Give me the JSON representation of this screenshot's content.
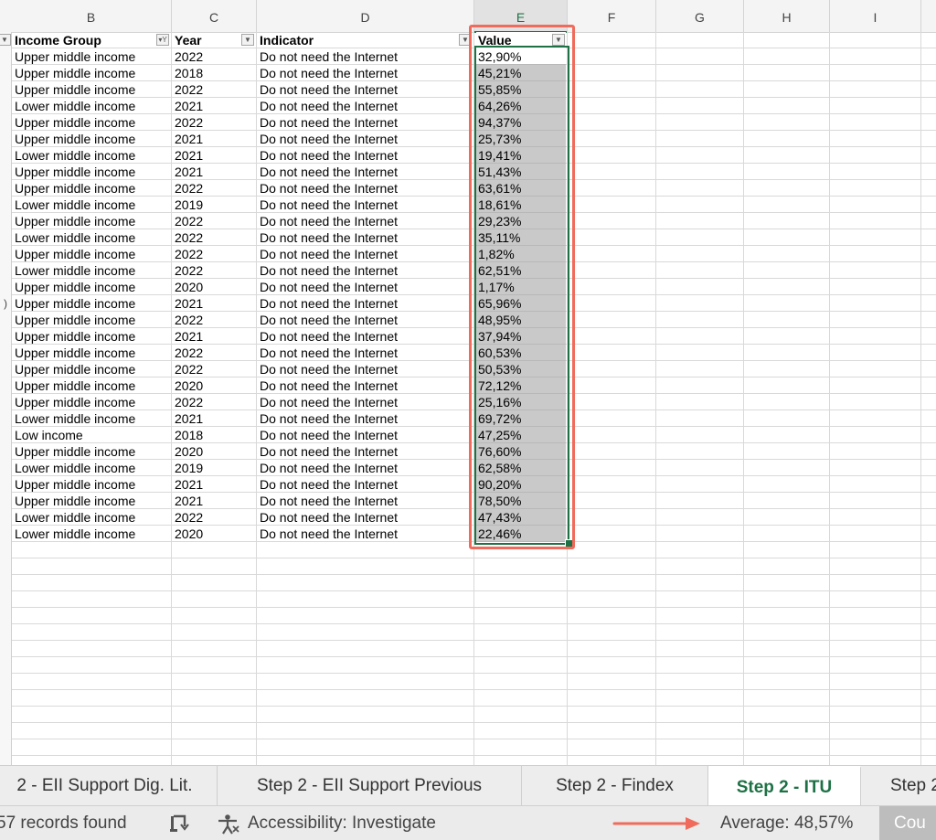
{
  "columns": {
    "b": "B",
    "c": "C",
    "d": "D",
    "e": "E",
    "f": "F",
    "g": "G",
    "h": "H",
    "i": "I"
  },
  "header": {
    "income_group": "Income Group",
    "year": "Year",
    "indicator": "Indicator",
    "value": "Value"
  },
  "row_stub_glyph": ")",
  "rows": [
    {
      "group": "Upper middle income",
      "year": "2022",
      "indicator": "Do not need the Internet",
      "value": "32,90%"
    },
    {
      "group": "Upper middle income",
      "year": "2018",
      "indicator": "Do not need the Internet",
      "value": "45,21%"
    },
    {
      "group": "Upper middle income",
      "year": "2022",
      "indicator": "Do not need the Internet",
      "value": "55,85%"
    },
    {
      "group": "Lower middle income",
      "year": "2021",
      "indicator": "Do not need the Internet",
      "value": "64,26%"
    },
    {
      "group": "Upper middle income",
      "year": "2022",
      "indicator": "Do not need the Internet",
      "value": "94,37%"
    },
    {
      "group": "Upper middle income",
      "year": "2021",
      "indicator": "Do not need the Internet",
      "value": "25,73%"
    },
    {
      "group": "Lower middle income",
      "year": "2021",
      "indicator": "Do not need the Internet",
      "value": "19,41%"
    },
    {
      "group": "Upper middle income",
      "year": "2021",
      "indicator": "Do not need the Internet",
      "value": "51,43%"
    },
    {
      "group": "Upper middle income",
      "year": "2022",
      "indicator": "Do not need the Internet",
      "value": "63,61%"
    },
    {
      "group": "Lower middle income",
      "year": "2019",
      "indicator": "Do not need the Internet",
      "value": "18,61%"
    },
    {
      "group": "Upper middle income",
      "year": "2022",
      "indicator": "Do not need the Internet",
      "value": "29,23%"
    },
    {
      "group": "Lower middle income",
      "year": "2022",
      "indicator": "Do not need the Internet",
      "value": "35,11%"
    },
    {
      "group": "Upper middle income",
      "year": "2022",
      "indicator": "Do not need the Internet",
      "value": "1,82%"
    },
    {
      "group": "Lower middle income",
      "year": "2022",
      "indicator": "Do not need the Internet",
      "value": "62,51%"
    },
    {
      "group": "Upper middle income",
      "year": "2020",
      "indicator": "Do not need the Internet",
      "value": "1,17%"
    },
    {
      "group": "Upper middle income",
      "year": "2021",
      "indicator": "Do not need the Internet",
      "value": "65,96%"
    },
    {
      "group": "Upper middle income",
      "year": "2022",
      "indicator": "Do not need the Internet",
      "value": "48,95%"
    },
    {
      "group": "Upper middle income",
      "year": "2021",
      "indicator": "Do not need the Internet",
      "value": "37,94%"
    },
    {
      "group": "Upper middle income",
      "year": "2022",
      "indicator": "Do not need the Internet",
      "value": "60,53%"
    },
    {
      "group": "Upper middle income",
      "year": "2022",
      "indicator": "Do not need the Internet",
      "value": "50,53%"
    },
    {
      "group": "Upper middle income",
      "year": "2020",
      "indicator": "Do not need the Internet",
      "value": "72,12%"
    },
    {
      "group": "Upper middle income",
      "year": "2022",
      "indicator": "Do not need the Internet",
      "value": "25,16%"
    },
    {
      "group": "Lower middle income",
      "year": "2021",
      "indicator": "Do not need the Internet",
      "value": "69,72%"
    },
    {
      "group": "Low income",
      "year": "2018",
      "indicator": "Do not need the Internet",
      "value": "47,25%"
    },
    {
      "group": "Upper middle income",
      "year": "2020",
      "indicator": "Do not need the Internet",
      "value": "76,60%"
    },
    {
      "group": "Lower middle income",
      "year": "2019",
      "indicator": "Do not need the Internet",
      "value": "62,58%"
    },
    {
      "group": "Upper middle income",
      "year": "2021",
      "indicator": "Do not need the Internet",
      "value": "90,20%"
    },
    {
      "group": "Upper middle income",
      "year": "2021",
      "indicator": "Do not need the Internet",
      "value": "78,50%"
    },
    {
      "group": "Lower middle income",
      "year": "2022",
      "indicator": "Do not need the Internet",
      "value": "47,43%"
    },
    {
      "group": "Lower middle income",
      "year": "2020",
      "indicator": "Do not need the Internet",
      "value": "22,46%"
    }
  ],
  "tabs": [
    {
      "label": "2 - EII Support Dig. Lit.",
      "active": false
    },
    {
      "label": "Step 2 - EII Support Previous",
      "active": false
    },
    {
      "label": "Step 2 - Findex",
      "active": false
    },
    {
      "label": "Step 2 - ITU",
      "active": true
    },
    {
      "label": "Step 2",
      "active": false
    }
  ],
  "status": {
    "records": "57 records found",
    "accessibility": "Accessibility: Investigate",
    "average": "Average: 48,57%",
    "count": "Cou"
  },
  "colors": {
    "excel_green": "#1e7145",
    "annotation_red": "#f06b5b",
    "selection_fill": "#c9c9c9"
  },
  "icons": {
    "filter_dropdown": "chevron-down-icon",
    "filter_active": "filter-icon",
    "macro": "macro-icon",
    "accessibility": "accessibility-icon",
    "arrow": "arrow-right-icon"
  }
}
